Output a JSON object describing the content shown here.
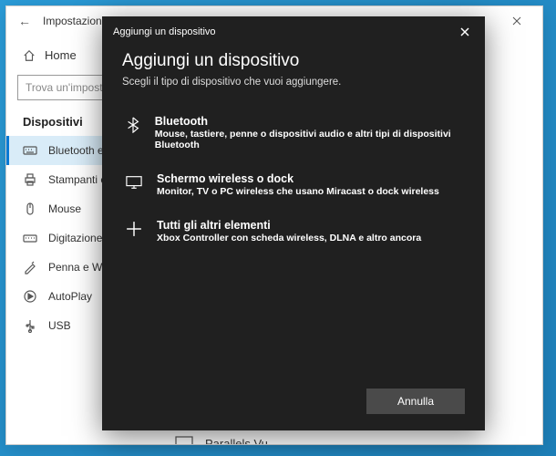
{
  "window": {
    "title": "Impostazioni"
  },
  "sidebar": {
    "home": "Home",
    "search_placeholder": "Trova un'impostazione",
    "section": "Dispositivi",
    "items": [
      {
        "label": "Bluetooth e altri dispositivi"
      },
      {
        "label": "Stampanti e scanner"
      },
      {
        "label": "Mouse"
      },
      {
        "label": "Digitazione"
      },
      {
        "label": "Penna e Windows Ink"
      },
      {
        "label": "AutoPlay"
      },
      {
        "label": "USB"
      }
    ]
  },
  "device_below": "Parallels Vu",
  "modal": {
    "head": "Aggiungi un dispositivo",
    "title": "Aggiungi un dispositivo",
    "subtitle": "Scegli il tipo di dispositivo che vuoi aggiungere.",
    "options": [
      {
        "title": "Bluetooth",
        "desc": "Mouse, tastiere, penne o dispositivi audio e altri tipi di dispositivi Bluetooth"
      },
      {
        "title": "Schermo wireless o dock",
        "desc": "Monitor, TV o PC wireless che usano Miracast o dock wireless"
      },
      {
        "title": "Tutti gli altri elementi",
        "desc": "Xbox Controller con scheda wireless, DLNA e altro ancora"
      }
    ],
    "cancel": "Annulla"
  }
}
